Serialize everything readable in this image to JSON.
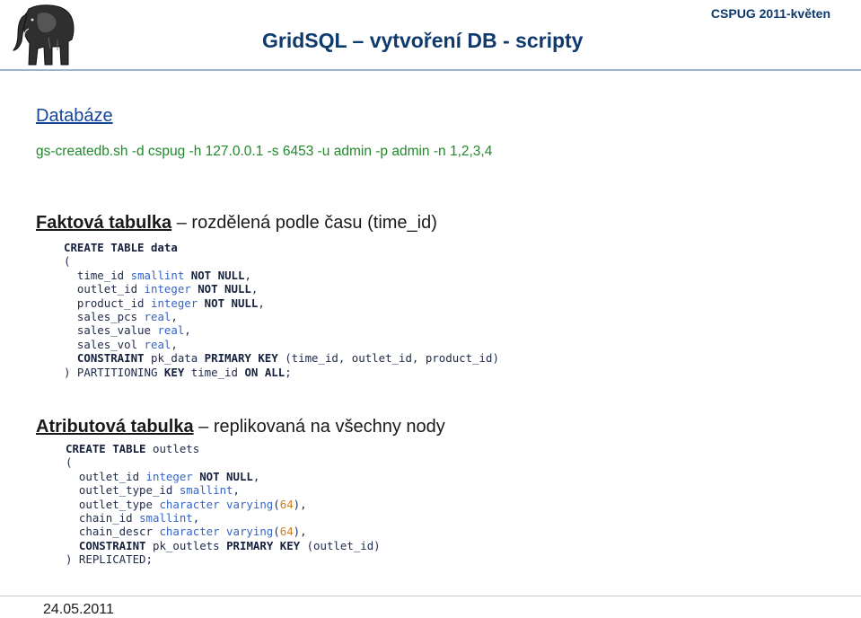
{
  "header": {
    "title": "GridSQL – vytvoření DB - scripty",
    "event": "CSPUG 2011-květen"
  },
  "sections": {
    "database": {
      "heading": "Databáze",
      "command": "gs-createdb.sh -d cspug -h 127.0.0.1 -s 6453 -u admin -p admin -n 1,2,3,4"
    },
    "fact_table": {
      "heading_bold": "Faktová tabulka",
      "heading_rest": " – rozdělená podle času (time_id)",
      "code_lines": [
        [
          {
            "t": "CREATE TABLE data",
            "c": "kw"
          }
        ],
        [
          {
            "t": "(",
            "c": ""
          }
        ],
        [
          {
            "t": "  time_id ",
            "c": ""
          },
          {
            "t": "smallint",
            "c": "ty"
          },
          {
            "t": " ",
            "c": ""
          },
          {
            "t": "NOT NULL",
            "c": "kw"
          },
          {
            "t": ",",
            "c": ""
          }
        ],
        [
          {
            "t": "  outlet_id ",
            "c": ""
          },
          {
            "t": "integer",
            "c": "ty"
          },
          {
            "t": " ",
            "c": ""
          },
          {
            "t": "NOT NULL",
            "c": "kw"
          },
          {
            "t": ",",
            "c": ""
          }
        ],
        [
          {
            "t": "  product_id ",
            "c": ""
          },
          {
            "t": "integer",
            "c": "ty"
          },
          {
            "t": " ",
            "c": ""
          },
          {
            "t": "NOT NULL",
            "c": "kw"
          },
          {
            "t": ",",
            "c": ""
          }
        ],
        [
          {
            "t": "  sales_pcs ",
            "c": ""
          },
          {
            "t": "real",
            "c": "ty"
          },
          {
            "t": ",",
            "c": ""
          }
        ],
        [
          {
            "t": "  sales_value ",
            "c": ""
          },
          {
            "t": "real",
            "c": "ty"
          },
          {
            "t": ",",
            "c": ""
          }
        ],
        [
          {
            "t": "  sales_vol ",
            "c": ""
          },
          {
            "t": "real",
            "c": "ty"
          },
          {
            "t": ",",
            "c": ""
          }
        ],
        [
          {
            "t": "  CONSTRAINT",
            "c": "kw"
          },
          {
            "t": " pk_data ",
            "c": ""
          },
          {
            "t": "PRIMARY KEY",
            "c": "kw"
          },
          {
            "t": " (time_id, outlet_id, product_id)",
            "c": ""
          }
        ],
        [
          {
            "t": ") PARTITIONING ",
            "c": ""
          },
          {
            "t": "KEY",
            "c": "kw"
          },
          {
            "t": " time_id ",
            "c": ""
          },
          {
            "t": "ON ALL",
            "c": "kw"
          },
          {
            "t": ";",
            "c": ""
          }
        ]
      ]
    },
    "attribute_table": {
      "heading_bold": "Atributová tabulka",
      "heading_rest": " – replikovaná na všechny nody",
      "code_lines": [
        [
          {
            "t": "CREATE TABLE",
            "c": "kw"
          },
          {
            "t": " outlets",
            "c": ""
          }
        ],
        [
          {
            "t": "(",
            "c": ""
          }
        ],
        [
          {
            "t": "  outlet_id ",
            "c": ""
          },
          {
            "t": "integer",
            "c": "ty"
          },
          {
            "t": " ",
            "c": ""
          },
          {
            "t": "NOT NULL",
            "c": "kw"
          },
          {
            "t": ",",
            "c": ""
          }
        ],
        [
          {
            "t": "  outlet_type_id ",
            "c": ""
          },
          {
            "t": "smallint",
            "c": "ty"
          },
          {
            "t": ",",
            "c": ""
          }
        ],
        [
          {
            "t": "  outlet_type ",
            "c": ""
          },
          {
            "t": "character varying",
            "c": "ty"
          },
          {
            "t": "(",
            "c": ""
          },
          {
            "t": "64",
            "c": "nm"
          },
          {
            "t": "),",
            "c": ""
          }
        ],
        [
          {
            "t": "  chain_id ",
            "c": ""
          },
          {
            "t": "smallint",
            "c": "ty"
          },
          {
            "t": ",",
            "c": ""
          }
        ],
        [
          {
            "t": "  chain_descr ",
            "c": ""
          },
          {
            "t": "character varying",
            "c": "ty"
          },
          {
            "t": "(",
            "c": ""
          },
          {
            "t": "64",
            "c": "nm"
          },
          {
            "t": "),",
            "c": ""
          }
        ],
        [
          {
            "t": "  CONSTRAINT",
            "c": "kw"
          },
          {
            "t": " pk_outlets ",
            "c": ""
          },
          {
            "t": "PRIMARY KEY",
            "c": "kw"
          },
          {
            "t": " (outlet_id)",
            "c": ""
          }
        ],
        [
          {
            "t": ") REPLICATED;",
            "c": ""
          }
        ]
      ]
    }
  },
  "footer": {
    "date": "24.05.2011"
  },
  "logo": {
    "icon": "postgresql-elephant-icon"
  }
}
